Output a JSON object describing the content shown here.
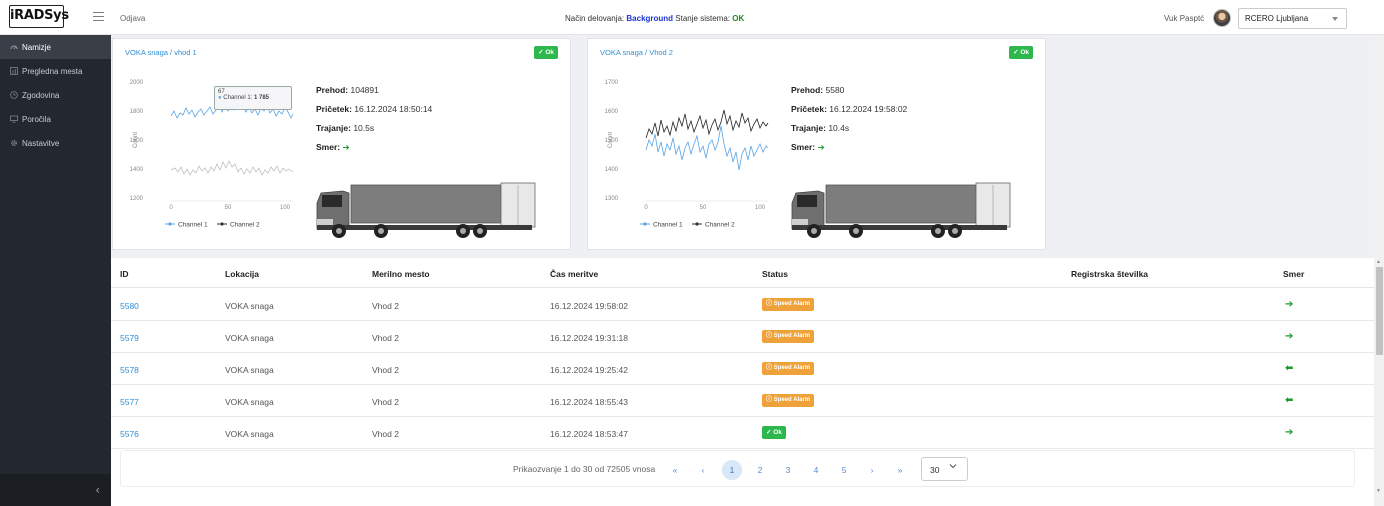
{
  "app": {
    "logo": "iRADSys",
    "logout": "Odjava"
  },
  "status": {
    "mode_label": "Način delovanja:",
    "mode_value": "Background",
    "state_label": "Stanje sistema:",
    "state_value": "OK"
  },
  "user": {
    "name": "Vuk Pasptć",
    "location": "RCERO Ljubljana"
  },
  "sidebar": {
    "items": [
      {
        "label": "Namizje",
        "icon": "dashboard-icon"
      },
      {
        "label": "Pregledna mesta",
        "icon": "grid-icon"
      },
      {
        "label": "Zgodovina",
        "icon": "history-icon"
      },
      {
        "label": "Poročila",
        "icon": "monitor-icon"
      },
      {
        "label": "Nastavitve",
        "icon": "gear-icon"
      }
    ],
    "collapse_glyph": "‹"
  },
  "cards": [
    {
      "title": "VOKA snaga / vhod 1",
      "badge": "✓ Ok",
      "prehod_label": "Prehod:",
      "prehod_value": " 104891",
      "zacetek_label": "Pričetek:",
      "zacetek_value": " 16.12.2024 18:50:14",
      "trajanje_label": "Trajanje:",
      "trajanje_value": " 10.5s",
      "smer_label": "Smer:",
      "smer_value": "➔",
      "tooltip": {
        "x": "67",
        "series": "Channel 1",
        "value": "1 785"
      },
      "chart": {
        "yticks": [
          "2000",
          "1800",
          "1600",
          "1400",
          "1200"
        ],
        "xticks": [
          "0",
          "50",
          "100"
        ],
        "ylabel": "Count",
        "legend": [
          "Channel 1",
          "Channel 2"
        ]
      }
    },
    {
      "title": "VOKA snaga / Vhod 2",
      "badge": "✓ Ok",
      "prehod_label": "Prehod:",
      "prehod_value": " 5580",
      "zacetek_label": "Pričetek:",
      "zacetek_value": " 16.12.2024 19:58:02",
      "trajanje_label": "Trajanje:",
      "trajanje_value": " 10.4s",
      "smer_label": "Smer:",
      "smer_value": "➔",
      "chart": {
        "yticks": [
          "1700",
          "1600",
          "1500",
          "1400",
          "1300"
        ],
        "xticks": [
          "0",
          "50",
          "100"
        ],
        "ylabel": "Count",
        "legend": [
          "Channel 1",
          "Channel 2"
        ]
      }
    }
  ],
  "table": {
    "headers": [
      "ID",
      "Lokacija",
      "Merilno mesto",
      "Čas meritve",
      "Status",
      "Registrska številka",
      "Smer"
    ],
    "rows": [
      {
        "id": "5580",
        "lokacija": "VOKA snaga",
        "mesto": "Vhod 2",
        "cas": "16.12.2024 19:58:02",
        "status": "ⓘ Speed Alarm",
        "status_type": "warn",
        "reg": "",
        "smer": "➔"
      },
      {
        "id": "5579",
        "lokacija": "VOKA snaga",
        "mesto": "Vhod 2",
        "cas": "16.12.2024 19:31:18",
        "status": "ⓘ Speed Alarm",
        "status_type": "warn",
        "reg": "",
        "smer": "➔"
      },
      {
        "id": "5578",
        "lokacija": "VOKA snaga",
        "mesto": "Vhod 2",
        "cas": "16.12.2024 19:25:42",
        "status": "ⓘ Speed Alarm",
        "status_type": "warn",
        "reg": "",
        "smer": "⬅"
      },
      {
        "id": "5577",
        "lokacija": "VOKA snaga",
        "mesto": "Vhod 2",
        "cas": "16.12.2024 18:55:43",
        "status": "ⓘ Speed Alarm",
        "status_type": "warn",
        "reg": "",
        "smer": "⬅"
      },
      {
        "id": "5576",
        "lokacija": "VOKA snaga",
        "mesto": "Vhod 2",
        "cas": "16.12.2024 18:53:47",
        "status": "✓ Ok",
        "status_type": "ok",
        "reg": "",
        "smer": "➔"
      }
    ]
  },
  "pagination": {
    "summary": "Prikaozvanje 1 do 30 od 72505 vnosa",
    "first": "«",
    "prev": "‹",
    "pages": [
      "1",
      "2",
      "3",
      "4",
      "5"
    ],
    "active_page": "1",
    "next": "›",
    "last": "»",
    "page_size": "30"
  },
  "colors": {
    "accent": "#2f8fd6",
    "ok": "#2db84d",
    "warn": "#f0a23a",
    "sidebar": "#23272e",
    "channel1": "#5aa4e6",
    "channel2": "#333333"
  }
}
